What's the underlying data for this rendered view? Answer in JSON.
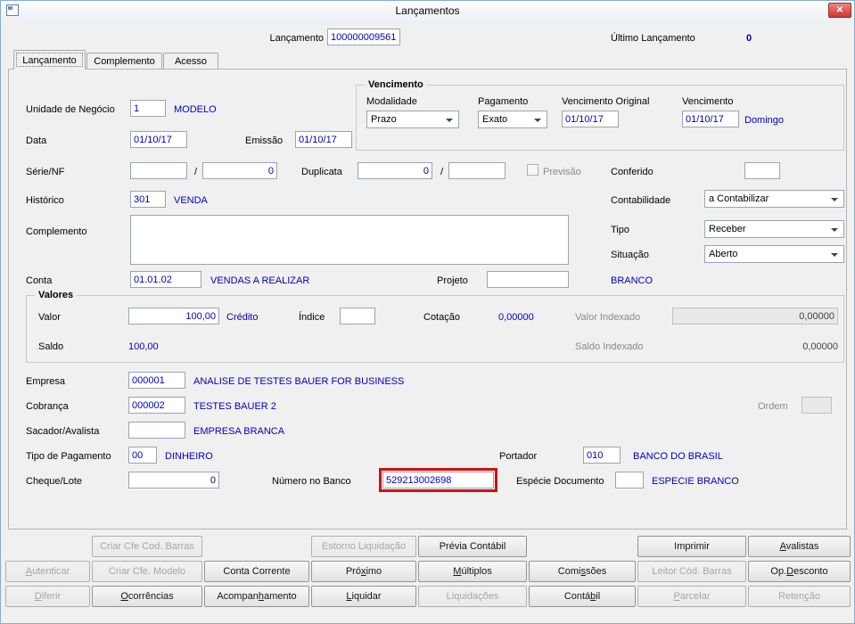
{
  "window": {
    "title": "Lançamentos",
    "close_glyph": "✕"
  },
  "header": {
    "lancamento_label": "Lançamento",
    "lancamento_value": "100000009561",
    "ultimo_lancamento_label": "Último Lançamento",
    "ultimo_lancamento_value": "0"
  },
  "tabs": {
    "lancamento": "Lançamento",
    "complemento": "Complemento",
    "acesso": "Acesso"
  },
  "form": {
    "unidade_negocio": {
      "label": "Unidade de Negócio",
      "value": "1",
      "desc": "MODELO"
    },
    "vencimento_group": {
      "title": "Vencimento",
      "modalidade": {
        "label": "Modalidade",
        "value": "Prazo"
      },
      "pagamento": {
        "label": "Pagamento",
        "value": "Exato"
      },
      "vencimento_original": {
        "label": "Vencimento Original",
        "value": "01/10/17"
      },
      "vencimento": {
        "label": "Vencimento",
        "value": "01/10/17",
        "desc": "Domingo"
      }
    },
    "data": {
      "label": "Data",
      "value": "01/10/17"
    },
    "emissao": {
      "label": "Emissão",
      "value": "01/10/17"
    },
    "serie_nf": {
      "label": "Série/NF",
      "value1": "",
      "sep": "/",
      "value2": "0"
    },
    "duplicata": {
      "label": "Duplicata",
      "value1": "0",
      "sep": "/",
      "value2": ""
    },
    "previsao": {
      "label": "Previsão",
      "checked": false
    },
    "conferido": {
      "label": "Conferido",
      "value": ""
    },
    "historico": {
      "label": "Histórico",
      "value": "301",
      "desc": "VENDA"
    },
    "contabilidade": {
      "label": "Contabilidade",
      "value": "a Contabilizar"
    },
    "complemento": {
      "label": "Complemento",
      "value": ""
    },
    "tipo": {
      "label": "Tipo",
      "value": "Receber"
    },
    "situacao": {
      "label": "Situação",
      "value": "Aberto"
    },
    "conta": {
      "label": "Conta",
      "value": "01.01.02",
      "desc": "VENDAS A REALIZAR"
    },
    "projeto": {
      "label": "Projeto",
      "value": "",
      "desc": "BRANCO"
    },
    "valores_group": {
      "title": "Valores",
      "valor": {
        "label": "Valor",
        "value": "100,00",
        "desc": "Crédito"
      },
      "indice": {
        "label": "Índice",
        "value": ""
      },
      "cotacao": {
        "label": "Cotação",
        "value": "0,00000"
      },
      "valor_indexado": {
        "label": "Valor Indexado",
        "value": "0,00000"
      },
      "saldo": {
        "label": "Saldo",
        "value": "100,00"
      },
      "saldo_indexado": {
        "label": "Saldo Indexado",
        "value": "0,00000"
      }
    },
    "empresa": {
      "label": "Empresa",
      "value": "000001",
      "desc": "ANALISE DE TESTES BAUER FOR BUSINESS"
    },
    "cobranca": {
      "label": "Cobrança",
      "value": "000002",
      "desc": "TESTES BAUER 2"
    },
    "ordem": {
      "label": "Ordem",
      "value": ""
    },
    "sacador_avalista": {
      "label": "Sacador/Avalista",
      "value": "",
      "desc": "EMPRESA BRANCA"
    },
    "tipo_pagamento": {
      "label": "Tipo de Pagamento",
      "value": "00",
      "desc": "DINHEIRO"
    },
    "portador": {
      "label": "Portador",
      "value": "010",
      "desc": "BANCO DO BRASIL"
    },
    "cheque_lote": {
      "label": "Cheque/Lote",
      "value": "0"
    },
    "numero_banco": {
      "label": "Número no Banco",
      "value": "529213002698",
      "highlighted": true
    },
    "especie_documento": {
      "label": "Espécie Documento",
      "value": "",
      "desc": "ESPECIE BRANCO"
    }
  },
  "buttons": [
    {
      "row": 1,
      "col": 2,
      "label": "Criar Cfe Cod. Barras",
      "enabled": false
    },
    {
      "row": 1,
      "col": 4,
      "label": "Estorno Liquidação",
      "enabled": false
    },
    {
      "row": 1,
      "col": 5,
      "label": "Prévia Contábil",
      "enabled": true
    },
    {
      "row": 1,
      "col": 7,
      "label": "Imprimir",
      "enabled": true
    },
    {
      "row": 1,
      "col": 8,
      "label": "&Avalistas",
      "enabled": true
    },
    {
      "row": 2,
      "col": 1,
      "label": "&Autenticar",
      "enabled": false
    },
    {
      "row": 2,
      "col": 2,
      "label": "Criar Cfe. Modelo",
      "enabled": false
    },
    {
      "row": 2,
      "col": 3,
      "label": "Conta Corrente",
      "enabled": true
    },
    {
      "row": 2,
      "col": 4,
      "label": "Pró&ximo",
      "enabled": true
    },
    {
      "row": 2,
      "col": 5,
      "label": "&Múltiplos",
      "enabled": true
    },
    {
      "row": 2,
      "col": 6,
      "label": "Comi&ssões",
      "enabled": true
    },
    {
      "row": 2,
      "col": 7,
      "label": "Leitor Cód. Barras",
      "enabled": false
    },
    {
      "row": 2,
      "col": 8,
      "label": "Op.&Desconto",
      "enabled": true
    },
    {
      "row": 3,
      "col": 1,
      "label": "&Diferir",
      "enabled": false
    },
    {
      "row": 3,
      "col": 2,
      "label": "&Ocorrências",
      "enabled": true
    },
    {
      "row": 3,
      "col": 3,
      "label": "Acompan&hamento",
      "enabled": true
    },
    {
      "row": 3,
      "col": 4,
      "label": "&Liquidar",
      "enabled": true
    },
    {
      "row": 3,
      "col": 5,
      "label": "Liquidações",
      "enabled": false
    },
    {
      "row": 3,
      "col": 6,
      "label": "Contá&bil",
      "enabled": true
    },
    {
      "row": 3,
      "col": 7,
      "label": "&Parcelar",
      "enabled": false
    },
    {
      "row": 3,
      "col": 8,
      "label": "Reten&ção",
      "enabled": false
    }
  ],
  "colors": {
    "field_text": "#0000c0",
    "desc_text": "#0000c0",
    "label_text": "#000000",
    "disabled_text": "#8a8a8a",
    "highlight_box": "#cf1110",
    "close_button": "#ce3530",
    "window_bg": "#f0f0f0"
  }
}
